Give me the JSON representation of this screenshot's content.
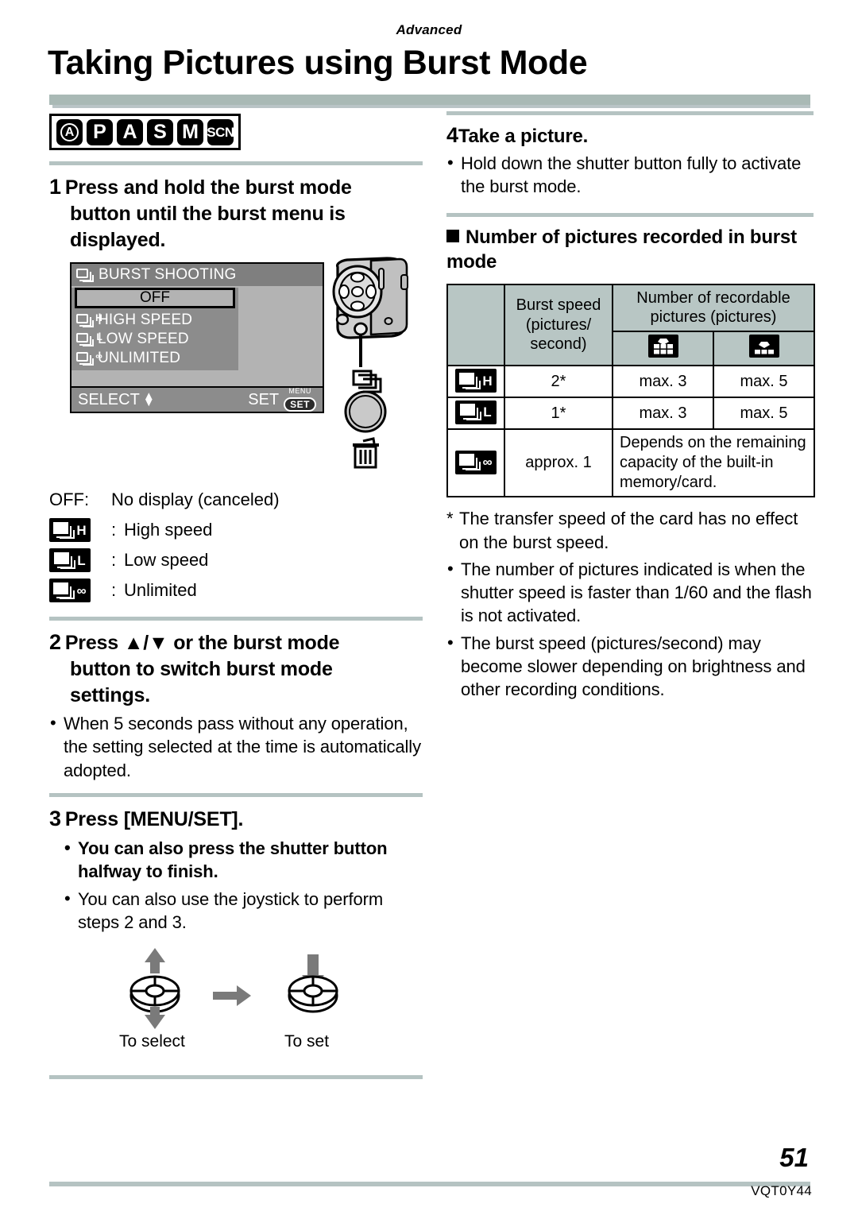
{
  "running_head": "Advanced",
  "title": "Taking Pictures using Burst Mode",
  "mode_badges": [
    {
      "name": "intelligent-auto",
      "label": "A"
    },
    {
      "name": "program",
      "label": "P"
    },
    {
      "name": "aperture-priority",
      "label": "A"
    },
    {
      "name": "shutter-priority",
      "label": "S"
    },
    {
      "name": "manual",
      "label": "M"
    },
    {
      "name": "scene",
      "label": "SCN"
    }
  ],
  "left": {
    "step1": {
      "num": "1",
      "line1": "Press and hold the burst mode",
      "line2": "button until the burst menu is",
      "line3": "displayed."
    },
    "lcd": {
      "title": "BURST SHOOTING",
      "selected": "OFF",
      "items": [
        "HIGH SPEED",
        "LOW SPEED",
        "UNLIMITED"
      ],
      "item_marks": [
        "H",
        "L",
        "∞"
      ],
      "select_label": "SELECT",
      "set_label": "SET",
      "menu_small_label": "MENU",
      "set_button_label": "SET"
    },
    "legend": [
      {
        "key": "OFF:",
        "mark": "",
        "value": "No display (canceled)"
      },
      {
        "key": "",
        "mark": "H",
        "value": "High speed"
      },
      {
        "key": "",
        "mark": "L",
        "value": "Low speed"
      },
      {
        "key": "",
        "mark": "∞",
        "value": "Unlimited"
      }
    ],
    "legend_colon": ":",
    "step2": {
      "num": "2",
      "line1": "Press ▲/▼ or the burst mode",
      "line2": "button to switch burst mode",
      "line3": "settings.",
      "bullet": "When 5 seconds pass without any operation, the setting selected at the time is automatically adopted."
    },
    "step3": {
      "num": "3",
      "heading": "Press [MENU/SET].",
      "bullet_bold": "You can also press the shutter button halfway to finish.",
      "bullet_plain": "You can also use the joystick to perform steps 2 and 3."
    },
    "joystick": {
      "to_select": "To select",
      "to_set": "To set"
    }
  },
  "right": {
    "step4": {
      "num": "4",
      "heading": "Take a picture.",
      "bullet": "Hold down the shutter button fully to activate the burst mode."
    },
    "section_heading": "Number of pictures recorded in burst mode",
    "table": {
      "col_burst_speed": "Burst speed (pictures/ second)",
      "col_burst_speed_l1": "Burst speed",
      "col_burst_speed_l2": "(pictures/",
      "col_burst_speed_l3": "second)",
      "col_recordable_l1": "Number of recordable",
      "col_recordable_l2": "pictures (pictures)",
      "quality_icons": [
        "fine-quality-icon",
        "standard-quality-icon"
      ],
      "rows": [
        {
          "mode": "H",
          "speed": "2*",
          "fine": "max. 3",
          "standard": "max. 5"
        },
        {
          "mode": "L",
          "speed": "1*",
          "fine": "max. 3",
          "standard": "max. 5"
        },
        {
          "mode": "∞",
          "speed": "approx. 1",
          "span": "Depends on the remaining capacity of the built-in memory/card."
        }
      ]
    },
    "footnote": "The transfer speed of the card has no effect on the burst speed.",
    "bullets": [
      "The number of pictures indicated is when the shutter speed is faster than 1/60 and the flash is not activated.",
      "The burst speed (pictures/second) may become slower depending on brightness and other recording conditions."
    ]
  },
  "footer": {
    "page_number": "51",
    "doc_code": "VQT0Y44"
  },
  "colors": {
    "rule": "#a9b9b5",
    "table_header": "#b8c6c4",
    "lcd_body": "#b3b3b3",
    "lcd_title": "#7f7f7f",
    "lcd_menu": "#8c8c8c"
  }
}
